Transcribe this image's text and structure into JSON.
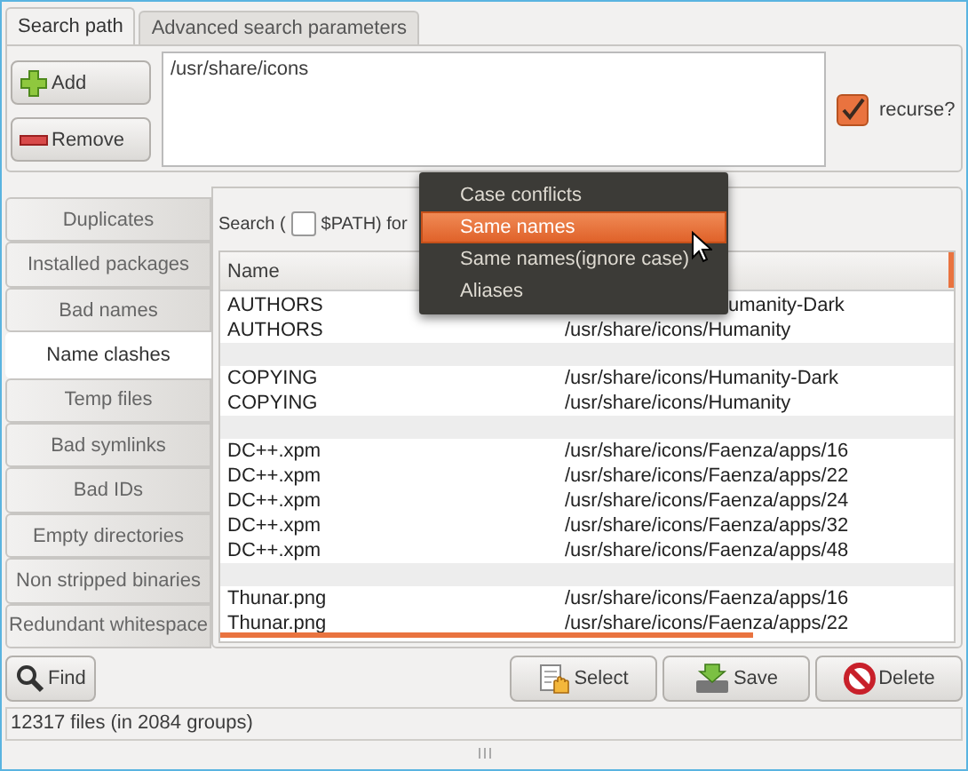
{
  "tabs": [
    {
      "label": "Search path",
      "selected": true
    },
    {
      "label": "Advanced search parameters",
      "selected": false
    }
  ],
  "path_buttons": [
    {
      "kind": "add",
      "label": "Add"
    },
    {
      "kind": "remove",
      "label": "Remove"
    }
  ],
  "paths": "/usr/share/icons",
  "recurse": {
    "label": "recurse?",
    "checked": true
  },
  "sidebar": {
    "items": [
      {
        "label": "Duplicates",
        "selected": false
      },
      {
        "label": "Installed packages",
        "selected": false
      },
      {
        "label": "Bad names",
        "selected": false
      },
      {
        "label": "Name clashes",
        "selected": true
      },
      {
        "label": "Temp files",
        "selected": false
      },
      {
        "label": "Bad symlinks",
        "selected": false
      },
      {
        "label": "Bad IDs",
        "selected": false
      },
      {
        "label": "Empty directories",
        "selected": false
      },
      {
        "label": "Non stripped binaries",
        "selected": false
      },
      {
        "label": "Redundant whitespace",
        "selected": false
      }
    ]
  },
  "search_line": {
    "prefix": "Search (",
    "path_checkbox": {
      "checked": false
    },
    "suffix": "$PATH) for"
  },
  "table": {
    "columns": [
      "Name"
    ],
    "groups": [
      {
        "rows": [
          [
            "AUTHORS",
            {
              "text": "umanity-Dark",
              "covered": true
            }
          ],
          [
            "AUTHORS",
            "/usr/share/icons/Humanity"
          ]
        ]
      },
      {
        "rows": [
          [
            "COPYING",
            "/usr/share/icons/Humanity-Dark"
          ],
          [
            "COPYING",
            "/usr/share/icons/Humanity"
          ]
        ]
      },
      {
        "rows": [
          [
            "DC++.xpm",
            "/usr/share/icons/Faenza/apps/16"
          ],
          [
            "DC++.xpm",
            "/usr/share/icons/Faenza/apps/22"
          ],
          [
            "DC++.xpm",
            "/usr/share/icons/Faenza/apps/24"
          ],
          [
            "DC++.xpm",
            "/usr/share/icons/Faenza/apps/32"
          ],
          [
            "DC++.xpm",
            "/usr/share/icons/Faenza/apps/48"
          ]
        ]
      },
      {
        "rows": [
          [
            "Thunar.png",
            "/usr/share/icons/Faenza/apps/16"
          ],
          [
            "Thunar.png",
            "/usr/share/icons/Faenza/apps/22"
          ]
        ]
      }
    ]
  },
  "menu": [
    {
      "label": "Case conflicts",
      "selected": false
    },
    {
      "label": "Same names",
      "selected": true
    },
    {
      "label": "Same names(ignore case)",
      "selected": false
    },
    {
      "label": "Aliases",
      "selected": false
    }
  ],
  "find_button": {
    "label": "Find"
  },
  "actions": [
    {
      "kind": "select",
      "label": "Select"
    },
    {
      "kind": "save",
      "label": "Save"
    },
    {
      "kind": "delete",
      "label": "Delete"
    }
  ],
  "status_bar": "12317 files (in 2084 groups)"
}
